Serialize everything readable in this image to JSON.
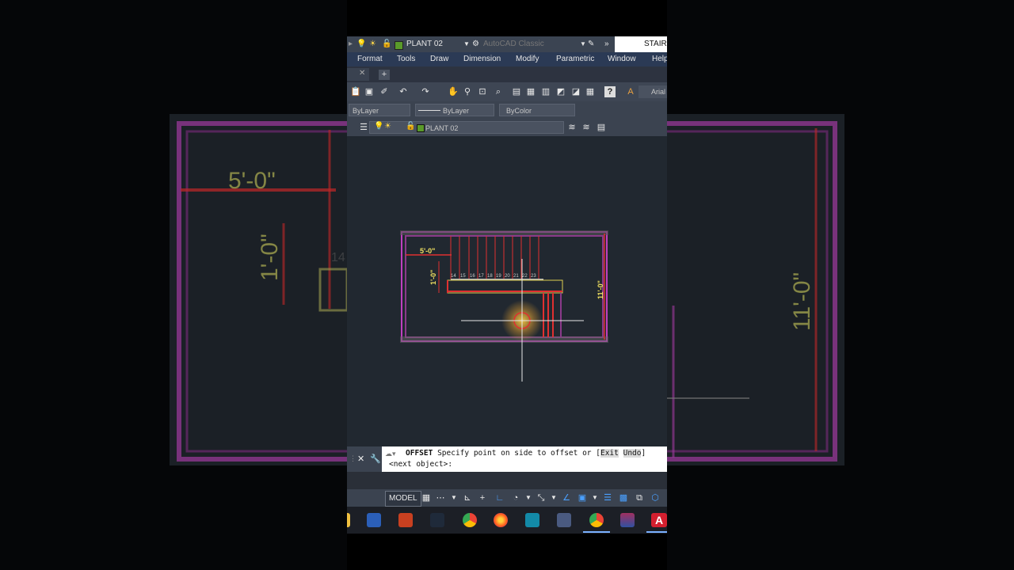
{
  "qat": {
    "layer_name": "PLANT 02",
    "workspace": "AutoCAD Classic",
    "doc_tab": "STAIRS"
  },
  "menu": {
    "items": [
      "Format",
      "Tools",
      "Draw",
      "Dimension",
      "Modify",
      "Parametric",
      "Window",
      "Help"
    ]
  },
  "tabs": {
    "close_glyph": "✕",
    "add_glyph": "+"
  },
  "toolbar": {
    "text_style": "Arial",
    "text_icon": "A"
  },
  "properties": {
    "color": "ByLayer",
    "linetype": "ByLayer",
    "lineweight": "ByColor"
  },
  "layers": {
    "current": "PLANT 02"
  },
  "drawing": {
    "dim_width": "5'-0\"",
    "dim_height": "11'-0\"",
    "dim_tread": "1'-0\"",
    "step_numbers": [
      "14",
      "15",
      "16",
      "17",
      "18",
      "19",
      "20",
      "21",
      "22",
      "23"
    ],
    "wall_color": "#c040c0",
    "stair_color": "#e03030",
    "dim_color": "#f0e060",
    "canvas_color": "#212830",
    "ghost_number": "14"
  },
  "command": {
    "name": "OFFSET",
    "prompt": "Specify point on side to offset or [",
    "option1": "Exit",
    "option2": "Undo",
    "prompt_end": "]",
    "line2": "<next object>:"
  },
  "status": {
    "model": "MODEL"
  },
  "taskbar": {
    "apps": [
      "file-explorer",
      "word",
      "autocad-2",
      "powershell",
      "chrome",
      "firefox",
      "media-player",
      "vlc",
      "chrome-2",
      "winrar",
      "autocad"
    ],
    "acad_glyph": "A"
  }
}
